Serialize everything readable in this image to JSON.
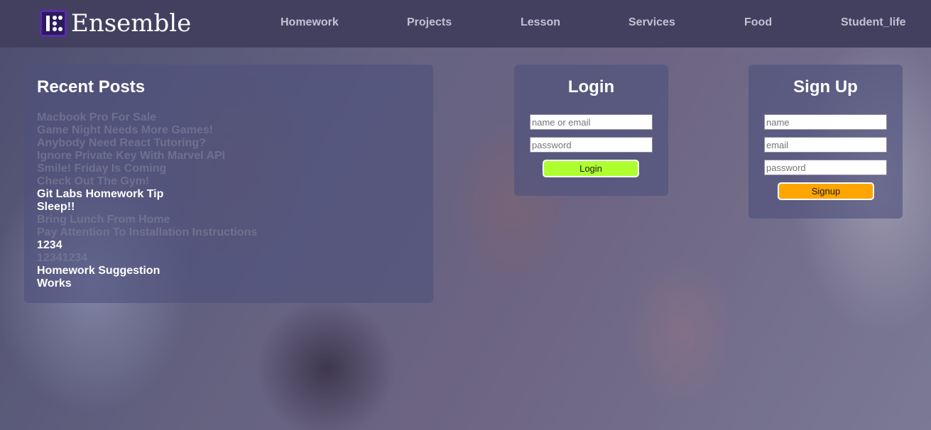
{
  "brand": {
    "name": "Ensemble",
    "logo_color": "#2b1b5e"
  },
  "nav": {
    "items": [
      {
        "label": "Homework"
      },
      {
        "label": "Projects"
      },
      {
        "label": "Lesson"
      },
      {
        "label": "Services"
      },
      {
        "label": "Food"
      },
      {
        "label": "Student_life"
      }
    ]
  },
  "recent_posts": {
    "title": "Recent Posts",
    "items": [
      {
        "label": "Macbook Pro For Sale",
        "highlighted": false
      },
      {
        "label": "Game Night Needs More Games!",
        "highlighted": false
      },
      {
        "label": "Anybody Need React Tutoring?",
        "highlighted": false
      },
      {
        "label": "Ignore Private Key With Marvel API",
        "highlighted": false
      },
      {
        "label": "Smile! Friday Is Coming",
        "highlighted": false
      },
      {
        "label": "Check Out The Gym!",
        "highlighted": false
      },
      {
        "label": "Git Labs Homework Tip",
        "highlighted": true
      },
      {
        "label": "Sleep!!",
        "highlighted": true
      },
      {
        "label": "Bring Lunch From Home",
        "highlighted": false
      },
      {
        "label": "Pay Attention To Installation Instructions",
        "highlighted": false
      },
      {
        "label": "1234",
        "highlighted": true
      },
      {
        "label": "12341234",
        "highlighted": false
      },
      {
        "label": "Homework Suggestion",
        "highlighted": true
      },
      {
        "label": "Works",
        "highlighted": true
      }
    ]
  },
  "login": {
    "title": "Login",
    "identity_placeholder": "name or email",
    "password_placeholder": "password",
    "button_label": "Login",
    "button_color": "#adff2f"
  },
  "signup": {
    "title": "Sign Up",
    "name_placeholder": "name",
    "email_placeholder": "email",
    "password_placeholder": "password",
    "button_label": "Signup",
    "button_color": "#ffa500"
  },
  "colors": {
    "header_bg": "#43405f",
    "nav_text": "#c3c2d3",
    "panel_bg": "rgba(78,80,125,0.62)"
  }
}
